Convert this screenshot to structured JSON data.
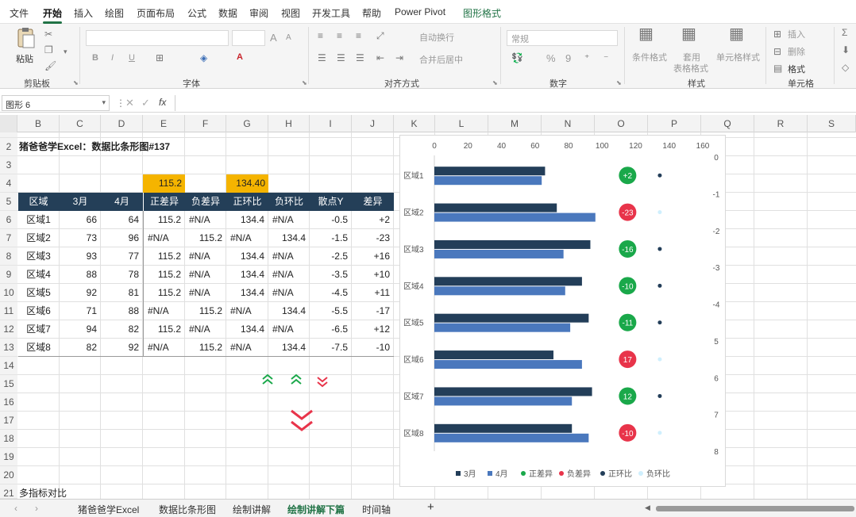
{
  "menu": [
    "文件",
    "开始",
    "插入",
    "绘图",
    "页面布局",
    "公式",
    "数据",
    "审阅",
    "视图",
    "开发工具",
    "帮助",
    "Power Pivot",
    "图形格式"
  ],
  "ribbon": {
    "clipboard": {
      "paste": "粘贴",
      "group": "剪贴板"
    },
    "font": {
      "bold": "B",
      "italic": "I",
      "underline": "U",
      "grow": "A",
      "shrink": "A",
      "color": "A",
      "group": "字体"
    },
    "align": {
      "wrap": "自动换行",
      "merge": "合并后居中",
      "group": "对齐方式"
    },
    "number": {
      "format": "常规",
      "percent": "%",
      "comma": "9",
      "group": "数字"
    },
    "styles": {
      "cond": "条件格式",
      "table1": "套用",
      "table2": "表格格式",
      "cell": "单元格样式",
      "group": "样式"
    },
    "cells": {
      "insert": "插入",
      "delete": "删除",
      "format": "格式",
      "group": "单元格"
    }
  },
  "formula": {
    "namebox": "图形 6",
    "fx": "fx"
  },
  "columns": [
    "B",
    "C",
    "D",
    "E",
    "F",
    "G",
    "H",
    "I",
    "J",
    "K",
    "L",
    "M",
    "N",
    "O",
    "P",
    "Q",
    "R",
    "S"
  ],
  "rows": [
    "2",
    "3",
    "4",
    "5",
    "6",
    "7",
    "8",
    "9",
    "10",
    "11",
    "12",
    "13",
    "14",
    "15",
    "16",
    "17",
    "18",
    "19",
    "20",
    "21"
  ],
  "sheet": {
    "title": "猪爸爸学Excel：数据比条形图#137",
    "e4": "115.2",
    "g4": "134.40",
    "headers": [
      "区域",
      "3月",
      "4月",
      "正差异",
      "负差异",
      "正环比",
      "负环比",
      "散点Y",
      "差异"
    ],
    "data": [
      [
        "区域1",
        "66",
        "64",
        "115.2",
        "#N/A",
        "134.4",
        "#N/A",
        "-0.5",
        "+2"
      ],
      [
        "区域2",
        "73",
        "96",
        "#N/A",
        "115.2",
        "#N/A",
        "134.4",
        "-1.5",
        "-23"
      ],
      [
        "区域3",
        "93",
        "77",
        "115.2",
        "#N/A",
        "134.4",
        "#N/A",
        "-2.5",
        "+16"
      ],
      [
        "区域4",
        "88",
        "78",
        "115.2",
        "#N/A",
        "134.4",
        "#N/A",
        "-3.5",
        "+10"
      ],
      [
        "区域5",
        "92",
        "81",
        "115.2",
        "#N/A",
        "134.4",
        "#N/A",
        "-4.5",
        "+11"
      ],
      [
        "区域6",
        "71",
        "88",
        "#N/A",
        "115.2",
        "#N/A",
        "134.4",
        "-5.5",
        "-17"
      ],
      [
        "区域7",
        "94",
        "82",
        "115.2",
        "#N/A",
        "134.4",
        "#N/A",
        "-6.5",
        "+12"
      ],
      [
        "区域8",
        "82",
        "92",
        "#N/A",
        "115.2",
        "#N/A",
        "134.4",
        "-7.5",
        "-10"
      ]
    ],
    "note": "多指标对比"
  },
  "colors": {
    "green": "#1aa84a",
    "red": "#e8344a",
    "dark": "#233e59",
    "blue": "#4a78bd",
    "light": "#cfeffd",
    "header": "#243f58",
    "orange": "#f5b400"
  },
  "chart_data": {
    "type": "bar",
    "categories": [
      "区域1",
      "区域2",
      "区域3",
      "区域4",
      "区域5",
      "区域6",
      "区域7",
      "区域8"
    ],
    "series": [
      {
        "name": "3月",
        "values": [
          66,
          73,
          93,
          88,
          92,
          71,
          94,
          82
        ]
      },
      {
        "name": "4月",
        "values": [
          64,
          96,
          77,
          78,
          81,
          88,
          82,
          92
        ]
      }
    ],
    "diff_labels": [
      "+2",
      "-23",
      "-16",
      "-10",
      "-11",
      "17",
      "12",
      "-10"
    ],
    "diff_values": [
      2,
      -23,
      16,
      10,
      11,
      -17,
      12,
      -10
    ],
    "xticks": [
      "0",
      "20",
      "40",
      "60",
      "80",
      "100",
      "120",
      "140",
      "160"
    ],
    "yticks": [
      "0",
      "-1",
      "-2",
      "-3",
      "-4",
      "5",
      "6",
      "7",
      "8"
    ],
    "xlim": [
      0,
      160
    ],
    "ylim": [
      -8,
      0
    ],
    "legend": [
      "3月",
      "4月",
      "正差异",
      "负差异",
      "正环比",
      "负环比"
    ],
    "legend_position": "bottom"
  },
  "tabs": [
    "猪爸爸学Excel",
    "数据比条形图",
    "绘制讲解",
    "绘制讲解下篇",
    "时间轴"
  ],
  "active_tab": "绘制讲解下篇",
  "arrow_icons": [
    "double-up-green-icon",
    "double-up-green-icon",
    "double-down-red-icon",
    "big-double-down-red-icon"
  ]
}
